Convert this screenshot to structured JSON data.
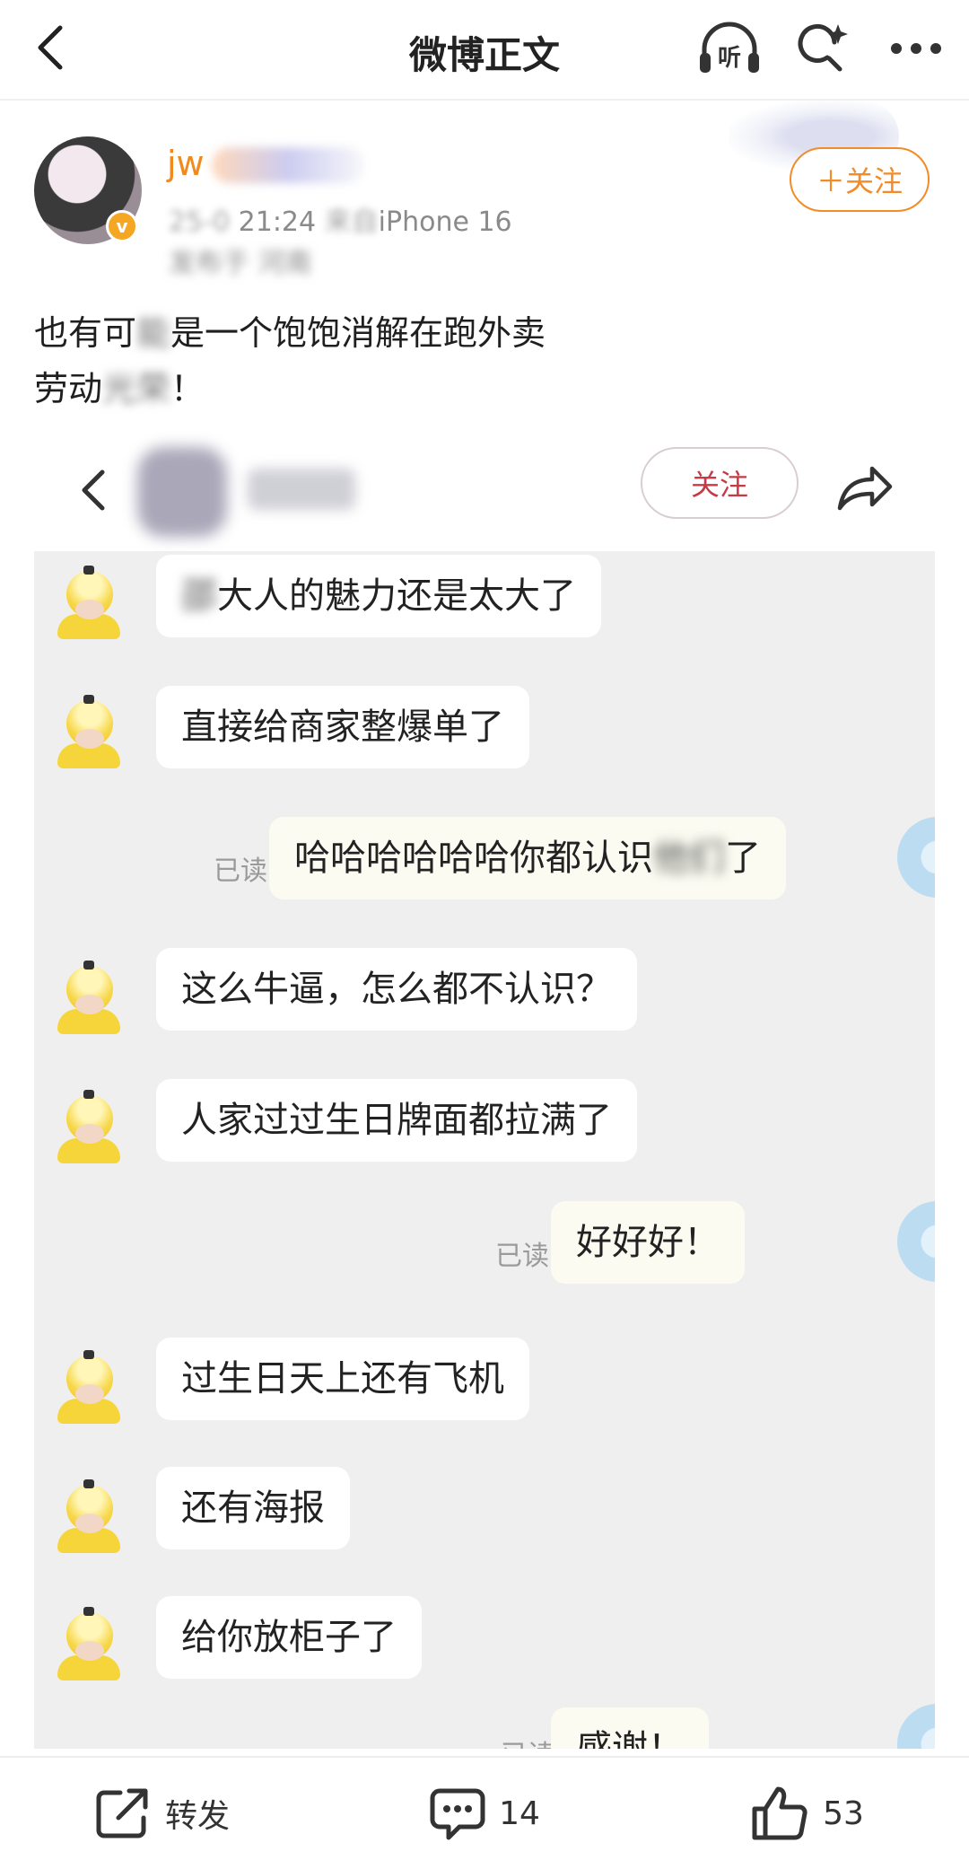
{
  "nav": {
    "title": "微博正文",
    "listen_label": "听"
  },
  "post": {
    "username": "jw",
    "meta_blurred": "25-0",
    "time": "21:24",
    "source_label": "来自",
    "device": "iPhone 16",
    "location_prefix": "发布于",
    "location": "河南",
    "follow_label": "＋关注",
    "text_line1_a": "也有可",
    "text_line1_blur": "能",
    "text_line1_b": "是一个饱饱消解在跑外卖",
    "text_line2_a": "劳动",
    "text_line2_blur": "光荣",
    "text_line2_b": "！"
  },
  "embedded_chat": {
    "follow_label": "关注",
    "messages": [
      {
        "side": "left",
        "text_blur": "邵",
        "text": "大人的魅力还是太大了"
      },
      {
        "side": "left",
        "text": "直接给商家整爆单了"
      },
      {
        "side": "right",
        "read": "已读",
        "text": "哈哈哈哈哈哈你都认识",
        "text_blur": "他们",
        "text_end": "了"
      },
      {
        "side": "left",
        "text": "这么牛逼，怎么都不认识？"
      },
      {
        "side": "left",
        "text": "人家过过生日牌面都拉满了"
      },
      {
        "side": "right",
        "read": "已读",
        "text": "好好好！"
      },
      {
        "side": "left",
        "text": "过生日天上还有飞机"
      },
      {
        "side": "left",
        "text": "还有海报"
      },
      {
        "side": "left",
        "text": "给你放柜子了"
      },
      {
        "side": "right",
        "read": "已读",
        "text": "感谢！"
      }
    ]
  },
  "bottom": {
    "repost_label": "转发",
    "comment_count": "14",
    "like_count": "53"
  },
  "colors": {
    "accent_orange": "#f28c28",
    "embed_follow_red": "#c53a45",
    "chat_bg": "#efefef"
  },
  "icons": [
    "back-arrow-icon",
    "headphones-icon",
    "search-sparkle-icon",
    "more-icon",
    "share-arrow-icon",
    "repost-icon",
    "comment-icon",
    "like-icon"
  ]
}
